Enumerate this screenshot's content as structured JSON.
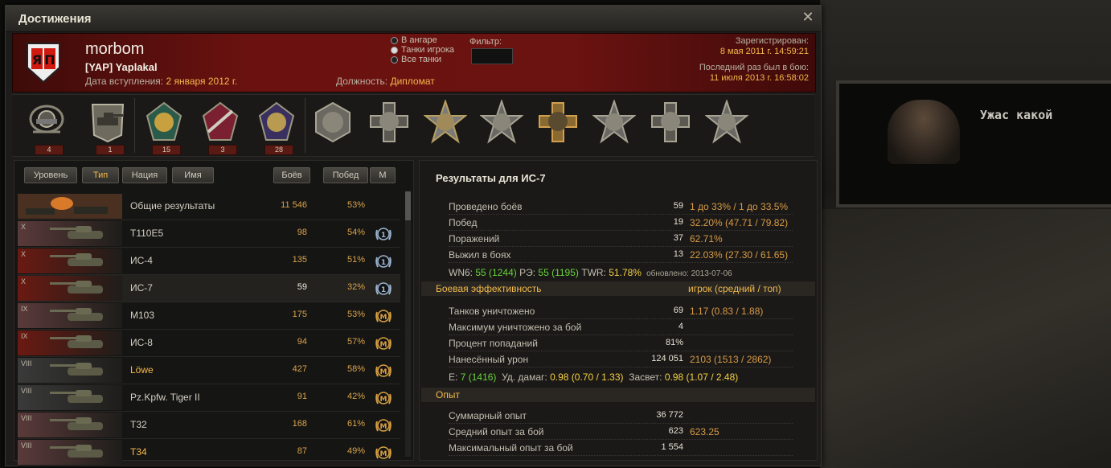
{
  "background": {
    "caption": "Ужас какой"
  },
  "window": {
    "title": "Достижения",
    "close": "✕"
  },
  "header": {
    "player_name": "morbom",
    "clan_tag": "[YAP]",
    "clan_name": "Yaplakal",
    "join_label": "Дата вступления:",
    "join_date": "2 января 2012 г.",
    "role_label": "Должность:",
    "role_value": "Дипломат",
    "radios": [
      "В ангаре",
      "Танки игрока",
      "Все танки"
    ],
    "radio_selected": 1,
    "filter_label": "Фильтр:",
    "registered_label": "Зарегистрирован:",
    "registered_date": "8 мая 2011 г. 14:59:21",
    "last_battle_label": "Последний раз был в бою:",
    "last_battle_date": "11 июля 2013 г. 16:58:02"
  },
  "achievements": [
    {
      "icon": "sniper-badge-icon",
      "count": "4"
    },
    {
      "icon": "tank-badge-icon",
      "count": "1"
    },
    {
      "icon": "class-medal-1-icon",
      "count": "15"
    },
    {
      "icon": "class-medal-2-icon",
      "count": "3"
    },
    {
      "icon": "class-medal-3-icon",
      "count": "28"
    },
    {
      "icon": "hero-medal-1-icon",
      "count": ""
    },
    {
      "icon": "hero-medal-2-icon",
      "count": ""
    },
    {
      "icon": "hero-medal-3-icon",
      "count": ""
    },
    {
      "icon": "hero-medal-4-icon",
      "count": ""
    },
    {
      "icon": "hero-medal-5-icon",
      "count": ""
    },
    {
      "icon": "hero-medal-6-icon",
      "count": ""
    },
    {
      "icon": "hero-medal-7-icon",
      "count": ""
    },
    {
      "icon": "hero-medal-8-icon",
      "count": ""
    }
  ],
  "sort_buttons": {
    "tier": "Уровень",
    "type": "Тип",
    "nation": "Нация",
    "name": "Имя",
    "battles": "Боёв",
    "wins": "Побед",
    "mastery": "M"
  },
  "tanks": [
    {
      "tier": "",
      "name": "Общие результаты",
      "battles": "11 546",
      "wins": "53%",
      "mastery": "",
      "flag": "#6a4a2a",
      "premium": false
    },
    {
      "tier": "X",
      "name": "T110E5",
      "battles": "98",
      "wins": "54%",
      "mastery": "1",
      "flag": "#5a3a3a",
      "premium": false
    },
    {
      "tier": "X",
      "name": "ИС-4",
      "battles": "135",
      "wins": "51%",
      "mastery": "1",
      "flag": "#6a1a12",
      "premium": false
    },
    {
      "tier": "X",
      "name": "ИС-7",
      "battles": "59",
      "wins": "32%",
      "mastery": "1",
      "flag": "#6a1a12",
      "premium": false
    },
    {
      "tier": "IX",
      "name": "M103",
      "battles": "175",
      "wins": "53%",
      "mastery": "M",
      "flag": "#5a3a3a",
      "premium": false
    },
    {
      "tier": "IX",
      "name": "ИС-8",
      "battles": "94",
      "wins": "57%",
      "mastery": "M",
      "flag": "#6a1a12",
      "premium": false
    },
    {
      "tier": "VIII",
      "name": "Löwe",
      "battles": "427",
      "wins": "58%",
      "mastery": "M",
      "flag": "#3a3a3a",
      "premium": true
    },
    {
      "tier": "VIII",
      "name": "Pz.Kpfw. Tiger II",
      "battles": "91",
      "wins": "42%",
      "mastery": "M",
      "flag": "#3a3a3a",
      "premium": false
    },
    {
      "tier": "VIII",
      "name": "T32",
      "battles": "168",
      "wins": "61%",
      "mastery": "M",
      "flag": "#5a3a3a",
      "premium": false
    },
    {
      "tier": "VIII",
      "name": "T34",
      "battles": "87",
      "wins": "49%",
      "mastery": "M",
      "flag": "#5a3a3a",
      "premium": true
    }
  ],
  "selected_tank_index": 3,
  "results": {
    "title": "Результаты для ИС-7",
    "battles_label": "Проведено боёв",
    "battles_value": "59",
    "battles_extra": "1 до 33% / 1 до 33.5%",
    "wins_label": "Побед",
    "wins_value": "19",
    "wins_extra": "32.20% (47.71 / 79.82)",
    "losses_label": "Поражений",
    "losses_value": "37",
    "losses_extra": "62.71%",
    "survived_label": "Выжил в боях",
    "survived_value": "13",
    "survived_extra": "22.03% (27.30 / 61.65)",
    "wn6_label": "WN6:",
    "wn6_value": "55",
    "wn6_extra": "(1244)",
    "re_label": "РЭ:",
    "re_value": "55",
    "re_extra": "(1195)",
    "twr_label": "TWR:",
    "twr_value": "51.78%",
    "updated_label": "обновлено:",
    "updated_value": "2013-07-06",
    "eff_title": "Боевая эффективность",
    "eff_cols": "игрок (средний / топ)",
    "kills_label": "Танков уничтожено",
    "kills_value": "69",
    "kills_extra": "1.17 (0.83 / 1.88)",
    "maxkills_label": "Максимум уничтожено за бой",
    "maxkills_value": "4",
    "accuracy_label": "Процент попаданий",
    "accuracy_value": "81%",
    "damage_label": "Нанесённый урон",
    "damage_value": "124 051",
    "damage_extra": "2103 (1513 / 2862)",
    "e_label": "E:",
    "e_value": "7",
    "e_extra": "(1416)",
    "dmg_label": "Уд. дамаг:",
    "dmg_value": "0.98",
    "dmg_p1": "(0.70",
    "dmg_p2": "/ 1.33)",
    "spot_label": "Засвет:",
    "spot_value": "0.98",
    "spot_p1": "(1.07",
    "spot_p2": "/ 2.48)",
    "exp_title": "Опыт",
    "totalexp_label": "Суммарный опыт",
    "totalexp_value": "36 772",
    "avgexp_label": "Средний опыт за бой",
    "avgexp_value": "623",
    "avgexp_extra": "623.25",
    "maxexp_label": "Максимальный опыт за бой",
    "maxexp_value": "1 554"
  }
}
